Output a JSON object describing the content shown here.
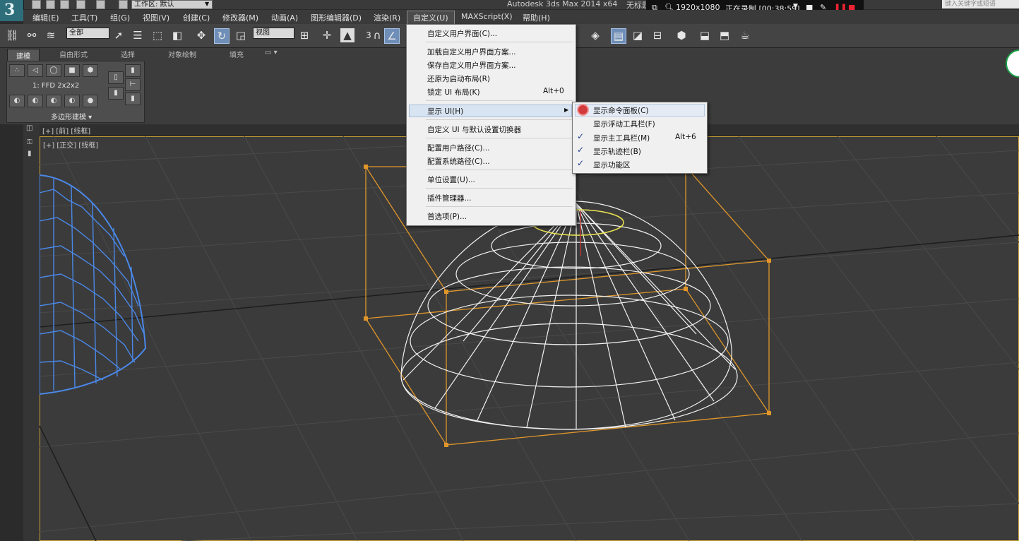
{
  "app": {
    "title": "Autodesk 3ds Max  2014 x64",
    "unnamed": "无标题",
    "workspace_label": "工作区: 默认"
  },
  "recorder": {
    "resolution": "1920x1080",
    "status": "正在录制 [00:38:59]"
  },
  "search": {
    "placeholder": "键入关键字或短语"
  },
  "menubar": {
    "items": [
      "编辑(E)",
      "工具(T)",
      "组(G)",
      "视图(V)",
      "创建(C)",
      "修改器(M)",
      "动画(A)",
      "图形编辑器(D)",
      "渲染(R)",
      "自定义(U)",
      "MAXScript(X)",
      "帮助(H)"
    ]
  },
  "toolbar": {
    "selection_filter": "全部",
    "ref_coord": "视图",
    "snap_value": "3"
  },
  "ribbon": {
    "tabs": [
      "建模",
      "自由形式",
      "选择",
      "对象绘制",
      "填充"
    ],
    "modifier_label": "1: FFD 2x2x2",
    "panel_label": "多边形建模 ▾"
  },
  "viewports": {
    "top_label": "[+] [前] [线框]",
    "main_label": "[+] [正交] [线框]"
  },
  "customize_menu": {
    "items": [
      {
        "label": "自定义用户界面(C)..."
      },
      {
        "label": "加载自定义用户界面方案..."
      },
      {
        "label": "保存自定义用户界面方案..."
      },
      {
        "label": "还原为启动布局(R)"
      },
      {
        "label": "锁定 UI 布局(K)",
        "shortcut": "Alt+0"
      },
      {
        "label": "显示 UI(H)"
      },
      {
        "label": "自定义 UI 与默认设置切换器"
      },
      {
        "label": "配置用户路径(C)..."
      },
      {
        "label": "配置系统路径(C)..."
      },
      {
        "label": "单位设置(U)..."
      },
      {
        "label": "插件管理器..."
      },
      {
        "label": "首选项(P)..."
      }
    ]
  },
  "show_ui_submenu": {
    "items": [
      {
        "label": "显示命令面板(C)",
        "checked": true
      },
      {
        "label": "显示浮动工具栏(F)",
        "checked": false
      },
      {
        "label": "显示主工具栏(M)",
        "checked": true,
        "shortcut": "Alt+6"
      },
      {
        "label": "显示轨迹栏(B)",
        "checked": true
      },
      {
        "label": "显示功能区",
        "checked": true
      }
    ]
  },
  "colors": {
    "accent_orange": "#e0962a",
    "wire_blue": "#4a88e8",
    "menu_highlight": "#d9e4f2"
  }
}
